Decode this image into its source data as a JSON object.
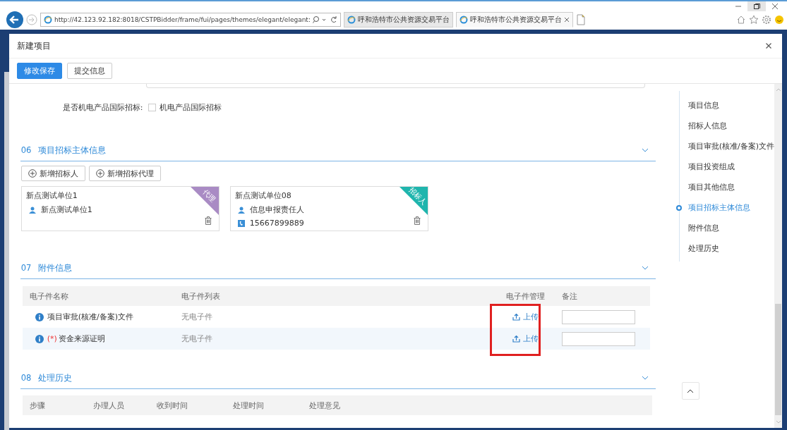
{
  "browser": {
    "url": "http://42.123.92.182:8018/CSTPBidder/frame/fui/pages/themes/elegant/elegant:",
    "tabs": [
      {
        "title": "呼和浩特市公共资源交易平台",
        "selected": false
      },
      {
        "title": "呼和浩特市公共资源交易平台",
        "selected": true
      }
    ]
  },
  "dialog": {
    "title": "新建项目"
  },
  "toolbar": [
    {
      "label": "修改保存",
      "kind": "primary"
    },
    {
      "label": "提交信息",
      "kind": "default"
    }
  ],
  "fields": [
    {
      "label": "是否机电产品国际招标:",
      "option": "机电产品国际招标",
      "checked": false
    }
  ],
  "sections": [
    {
      "number": "06",
      "title": "项目招标主体信息",
      "kind": "parties",
      "add_buttons": [
        "新增招标人",
        "新增招标代理"
      ],
      "cards": [
        {
          "name": "新点测试单位1",
          "contact": "新点测试单位1",
          "role": "代理",
          "color": "#a98bc4"
        },
        {
          "name": "新点测试单位08",
          "contact": "信息申报责任人",
          "phone": "15667899889",
          "role": "招标人",
          "color": "#1fb5ad"
        }
      ]
    },
    {
      "number": "07",
      "title": "附件信息",
      "kind": "attachments",
      "columns": [
        "电子件名称",
        "电子件列表",
        "电子件管理",
        "备注"
      ],
      "rows": [
        {
          "name": "项目审批(核准/备案)文件",
          "required": false,
          "files": "无电子件",
          "action": "上传"
        },
        {
          "name": "资金来源证明",
          "required": true,
          "required_mark": "(*)",
          "files": "无电子件",
          "action": "上传"
        }
      ],
      "highlighted": true
    },
    {
      "number": "08",
      "title": "处理历史",
      "kind": "history",
      "columns": [
        "步骤",
        "办理人员",
        "收到时间",
        "处理时间",
        "处理意见"
      ]
    }
  ],
  "nav": [
    {
      "label": "项目信息",
      "selected": false
    },
    {
      "label": "招标人信息",
      "selected": false
    },
    {
      "label": "项目审批(核准/备案)文件",
      "selected": false
    },
    {
      "label": "项目投资组成",
      "selected": false
    },
    {
      "label": "项目其他信息",
      "selected": false
    },
    {
      "label": "项目招标主体信息",
      "selected": true
    },
    {
      "label": "附件信息",
      "selected": false
    },
    {
      "label": "处理历史",
      "selected": false
    }
  ]
}
